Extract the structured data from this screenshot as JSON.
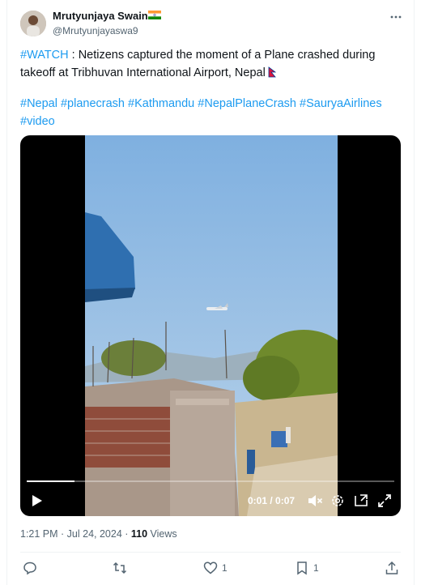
{
  "author": {
    "name": "Mrutyunjaya Swain",
    "handle": "@Mrutyunjayaswa9",
    "flag_icon": "india-flag-icon"
  },
  "tweet": {
    "hashtag_watch": "#WATCH",
    "line1_text": " : Netizens captured the moment of a Plane crashed during takeoff at Tribhuvan International Airport,  Nepal",
    "hashtags": [
      "#Nepal",
      "#planecrash",
      "#Kathmandu",
      "#NepalPlaneCrash",
      "#SauryaAirlines",
      "#video"
    ]
  },
  "video": {
    "time_current": "0:01",
    "time_sep": " / ",
    "time_total": "0:07",
    "progress": 0.13
  },
  "meta": {
    "time": "1:21 PM",
    "dot": " · ",
    "date": "Jul 24, 2024",
    "views_count": "110",
    "views_label": " Views"
  },
  "actions": {
    "reply_count": "",
    "retweet_count": "",
    "like_count": "1",
    "bookmark_count": "1"
  },
  "colors": {
    "link": "#1d9bf0",
    "text": "#0f1419",
    "muted": "#536471"
  }
}
